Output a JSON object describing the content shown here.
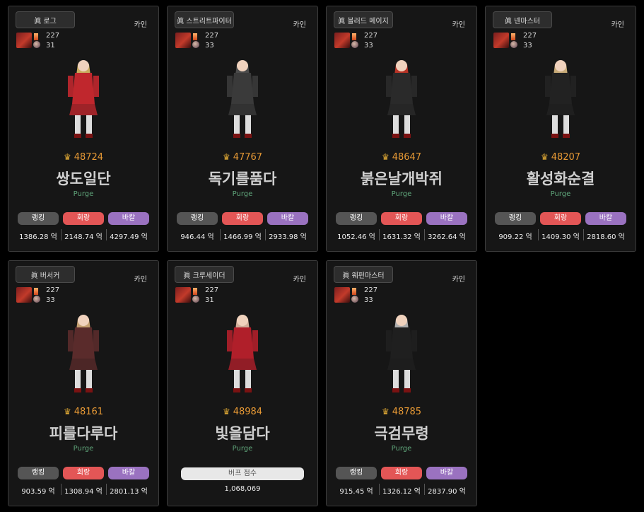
{
  "stat_labels": {
    "ranking": "랭킹",
    "heal": "회랑",
    "back": "바칼"
  },
  "cards": [
    {
      "job": "眞 로그",
      "server": "카인",
      "level1": "227",
      "level2": "31",
      "fame": "48724",
      "name": "쌍도일단",
      "adventure": "Purge",
      "stats": [
        "1386.28 억",
        "2148.74 억",
        "4297.49 억"
      ],
      "outfit": "#c0272d",
      "hair": "#e9c56b"
    },
    {
      "job": "眞 스트리트파이터",
      "server": "카인",
      "level1": "227",
      "level2": "33",
      "fame": "47767",
      "name": "독기를품다",
      "adventure": "Purge",
      "stats": [
        "946.44 억",
        "1466.99 억",
        "2933.98 억"
      ],
      "outfit": "#3a3a3a",
      "hair": "#555"
    },
    {
      "job": "眞 블러드 메이지",
      "server": "카인",
      "level1": "227",
      "level2": "33",
      "fame": "48647",
      "name": "붉은날개박쥐",
      "adventure": "Purge",
      "stats": [
        "1052.46 억",
        "1631.32 억",
        "3262.64 억"
      ],
      "outfit": "#2a2a2a",
      "hair": "#d33a2a"
    },
    {
      "job": "眞 넨마스터",
      "server": "카인",
      "level1": "227",
      "level2": "33",
      "fame": "48207",
      "name": "활성화순결",
      "adventure": "Purge",
      "stats": [
        "909.22 억",
        "1409.30 억",
        "2818.60 억"
      ],
      "outfit": "#222",
      "hair": "#e8c68a"
    },
    {
      "job": "眞 버서커",
      "server": "카인",
      "level1": "227",
      "level2": "33",
      "fame": "48161",
      "name": "피를다루다",
      "adventure": "Purge",
      "stats": [
        "903.59 억",
        "1308.94 억",
        "2801.13 억"
      ],
      "outfit": "#5a2b2b",
      "hair": "#e2b780"
    },
    {
      "job": "眞 크루세이더",
      "server": "카인",
      "level1": "227",
      "level2": "31",
      "fame": "48984",
      "name": "빛을담다",
      "adventure": "Purge",
      "buff_label": "버프 점수",
      "buff_value": "1,068,069",
      "outfit": "#b01f2a",
      "hair": "#f0c8b0"
    },
    {
      "job": "眞 웨펀마스터",
      "server": "카인",
      "level1": "227",
      "level2": "33",
      "fame": "48785",
      "name": "극검무령",
      "adventure": "Purge",
      "stats": [
        "915.45 억",
        "1326.12 억",
        "2837.90 억"
      ],
      "outfit": "#1f1f1f",
      "hair": "#c8c8c8"
    }
  ]
}
